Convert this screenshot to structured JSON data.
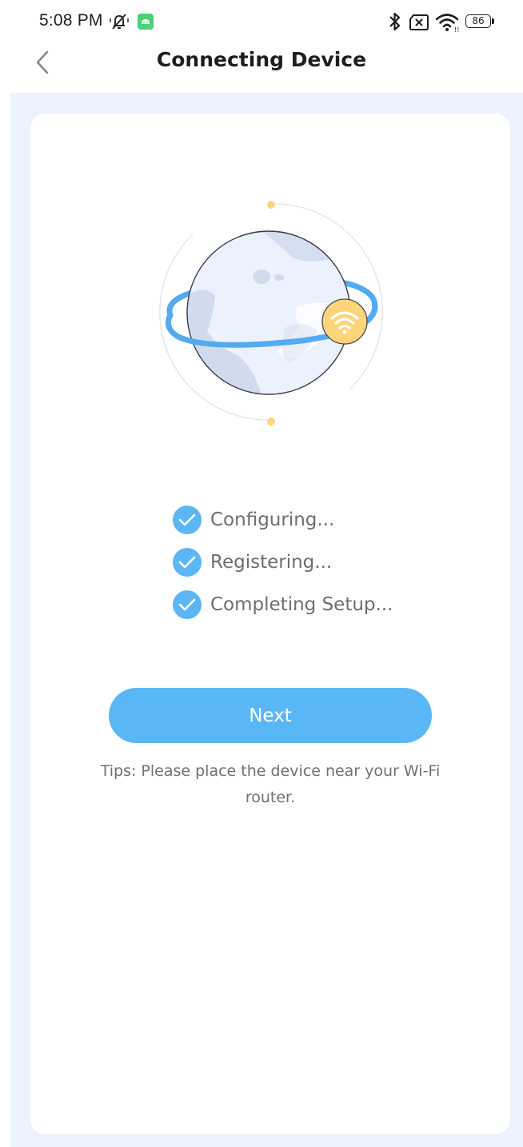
{
  "status_bar": {
    "time": "5:08 PM",
    "battery": "86",
    "icons": [
      "muted-notification-icon",
      "android-app-icon",
      "bluetooth-icon",
      "no-sim-icon",
      "wifi-signal-icon",
      "battery-icon"
    ]
  },
  "header": {
    "title": "Connecting Device",
    "back_icon": "chevron-left-icon"
  },
  "illustration": {
    "name": "globe-wifi-illustration",
    "colors": {
      "globe": "#ecf2fd",
      "land": "#cfdbee",
      "ring": "#53aaf1",
      "wifi_badge": "#fcd57a",
      "dots": "#fcd57a"
    }
  },
  "steps": [
    {
      "label": "Configuring...",
      "done": true
    },
    {
      "label": "Registering...",
      "done": true
    },
    {
      "label": "Completing Setup...",
      "done": true
    }
  ],
  "actions": {
    "next_label": "Next"
  },
  "tips": "Tips: Please place the device near your Wi-Fi router.",
  "colors": {
    "accent": "#5ab7f6",
    "page_bg": "#edf3fe",
    "card_bg": "#ffffff"
  }
}
